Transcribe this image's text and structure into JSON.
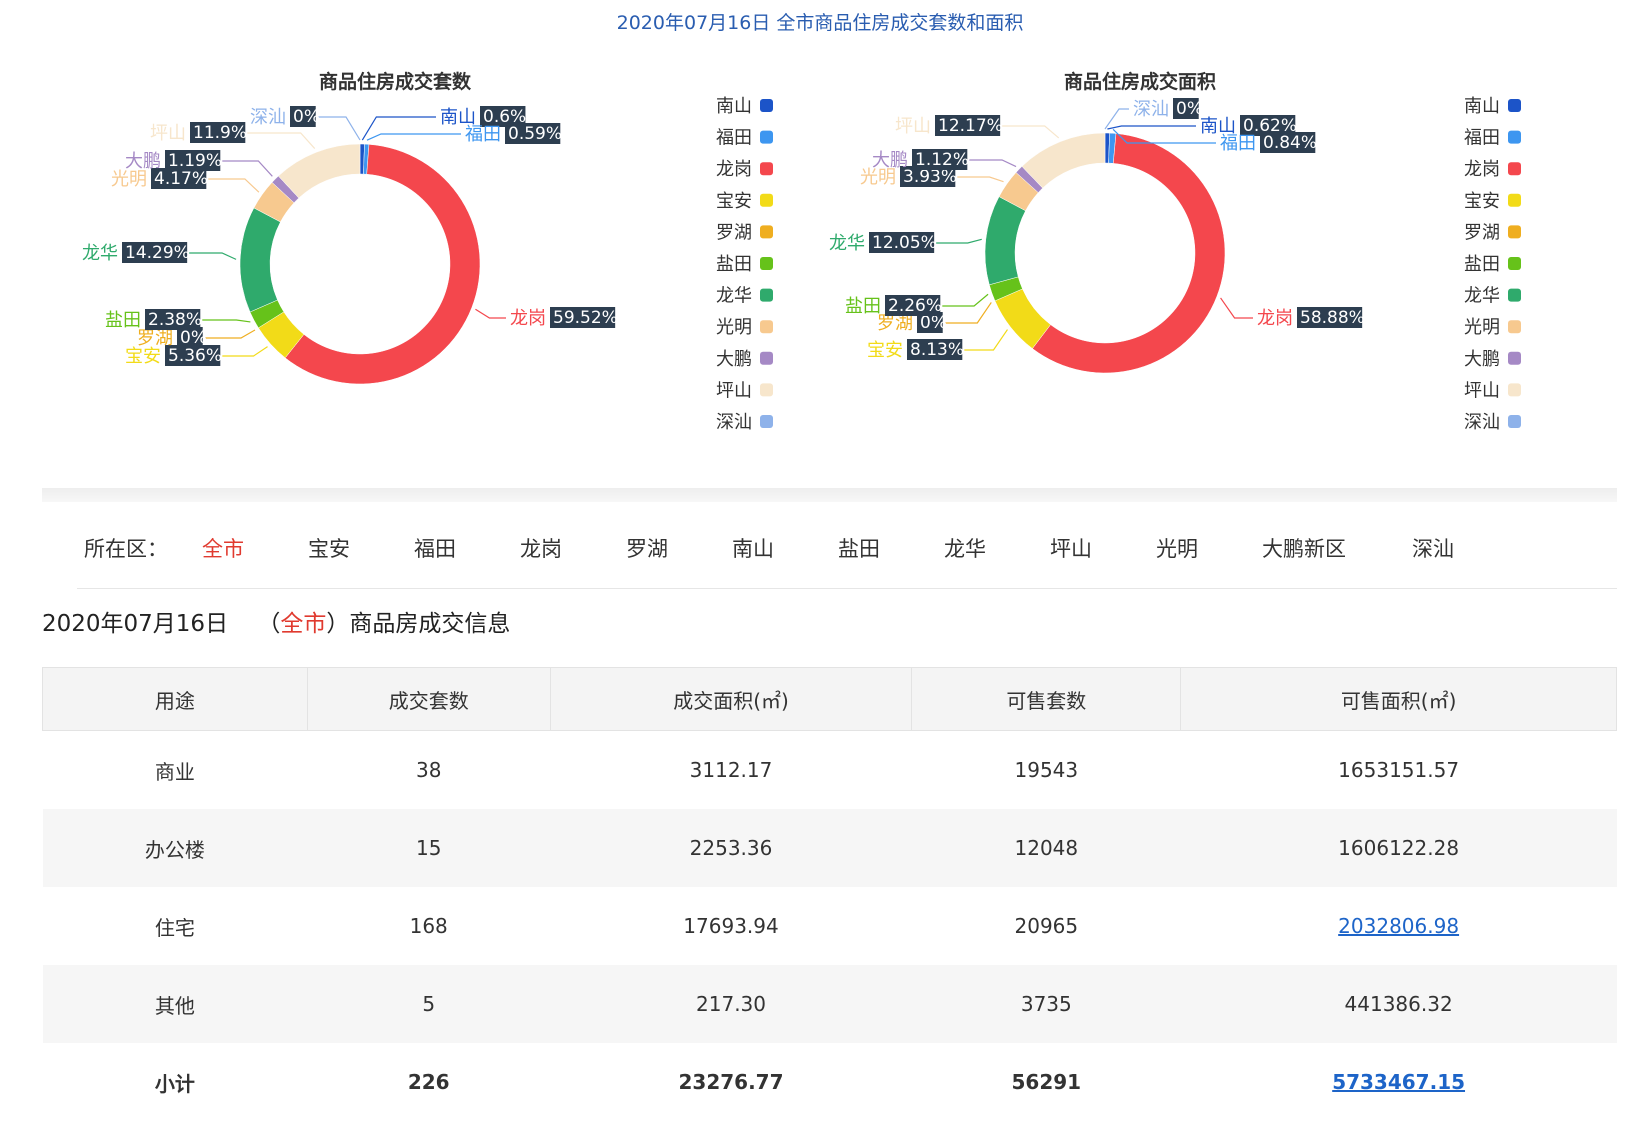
{
  "page_title": "2020年07月16日 全市商品住房成交套数和面积",
  "colors": {
    "南山": "#1c54c8",
    "福田": "#3d96f0",
    "龙岗": "#f4474d",
    "宝安": "#f2db18",
    "罗湖": "#efae20",
    "盐田": "#66c21a",
    "龙华": "#2faa6c",
    "光明": "#f7c98f",
    "大鹏": "#a589c5",
    "坪山": "#f7e6cc",
    "深汕": "#8eb2ea"
  },
  "chart_data": [
    {
      "type": "pie",
      "title": "商品住房成交套数",
      "categories": [
        "南山",
        "福田",
        "龙岗",
        "宝安",
        "罗湖",
        "盐田",
        "龙华",
        "光明",
        "大鹏",
        "坪山",
        "深汕"
      ],
      "values": [
        0.6,
        0.59,
        59.52,
        5.36,
        0,
        2.38,
        14.29,
        4.17,
        1.19,
        11.9,
        0
      ],
      "labels": [
        "0.6%",
        "0.59%",
        "59.52%",
        "5.36%",
        "0%",
        "2.38%",
        "14.29%",
        "4.17%",
        "1.19%",
        "11.9%",
        "0%"
      ],
      "legend": [
        "南山",
        "福田",
        "龙岗",
        "宝安",
        "罗湖",
        "盐田",
        "龙华",
        "光明",
        "大鹏",
        "坪山",
        "深汕"
      ]
    },
    {
      "type": "pie",
      "title": "商品住房成交面积",
      "categories": [
        "南山",
        "福田",
        "龙岗",
        "宝安",
        "罗湖",
        "盐田",
        "龙华",
        "光明",
        "大鹏",
        "坪山",
        "深汕"
      ],
      "values": [
        0.62,
        0.84,
        58.88,
        8.13,
        0,
        2.26,
        12.05,
        3.93,
        1.12,
        12.17,
        0
      ],
      "labels": [
        "0.62%",
        "0.84%",
        "58.88%",
        "8.13%",
        "0%",
        "2.26%",
        "12.05%",
        "3.93%",
        "1.12%",
        "12.17%",
        "0%"
      ],
      "legend": [
        "南山",
        "福田",
        "龙岗",
        "宝安",
        "罗湖",
        "盐田",
        "龙华",
        "光明",
        "大鹏",
        "坪山",
        "深汕"
      ]
    }
  ],
  "district_filter": {
    "label": "所在区：",
    "tabs": [
      "全市",
      "宝安",
      "福田",
      "龙岗",
      "罗湖",
      "南山",
      "盐田",
      "龙华",
      "坪山",
      "光明",
      "大鹏新区",
      "深汕"
    ],
    "active": "全市"
  },
  "info": {
    "date": "2020年07月16日",
    "open": "（",
    "scope": "全市",
    "close": "）商品房成交信息"
  },
  "table": {
    "headers": [
      "用途",
      "成交套数",
      "成交面积(㎡)",
      "可售套数",
      "可售面积(㎡)"
    ],
    "rows": [
      {
        "use": "商业",
        "deals": "38",
        "area": "3112.17",
        "avail": "19543",
        "avail_area": "1653151.57",
        "link": false
      },
      {
        "use": "办公楼",
        "deals": "15",
        "area": "2253.36",
        "avail": "12048",
        "avail_area": "1606122.28",
        "link": false
      },
      {
        "use": "住宅",
        "deals": "168",
        "area": "17693.94",
        "avail": "20965",
        "avail_area": "2032806.98",
        "link": true
      },
      {
        "use": "其他",
        "deals": "5",
        "area": "217.30",
        "avail": "3735",
        "avail_area": "441386.32",
        "link": false
      }
    ],
    "total": {
      "use": "小计",
      "deals": "226",
      "area": "23276.77",
      "avail": "56291",
      "avail_area": "5733467.15",
      "link": true
    }
  }
}
